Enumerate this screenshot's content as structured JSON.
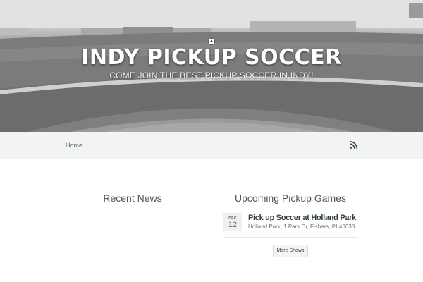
{
  "hero": {
    "title": "INDY PICKUP SOCCER",
    "tagline": "COME JOIN THE BEST PICKUP SOCCER IN INDY!",
    "logo_icon": "soccer-ball-icon"
  },
  "nav": {
    "items": [
      {
        "label": "Home"
      }
    ],
    "rss_icon": "rss-icon"
  },
  "news": {
    "title": "Recent News"
  },
  "games": {
    "title": "Upcoming Pickup Games",
    "events": [
      {
        "month": "DEC",
        "day": "12",
        "name": "Pick up Soccer at Holland Park",
        "address": "Holland Park, 1 Park Dr, Fishers, IN 46038"
      }
    ],
    "more_label": "More Shows"
  },
  "colors": {
    "nav_bg": "#f2f3f3",
    "heading": "#4d575a",
    "event_name": "#2f3d40",
    "rss": "#3c4749"
  }
}
